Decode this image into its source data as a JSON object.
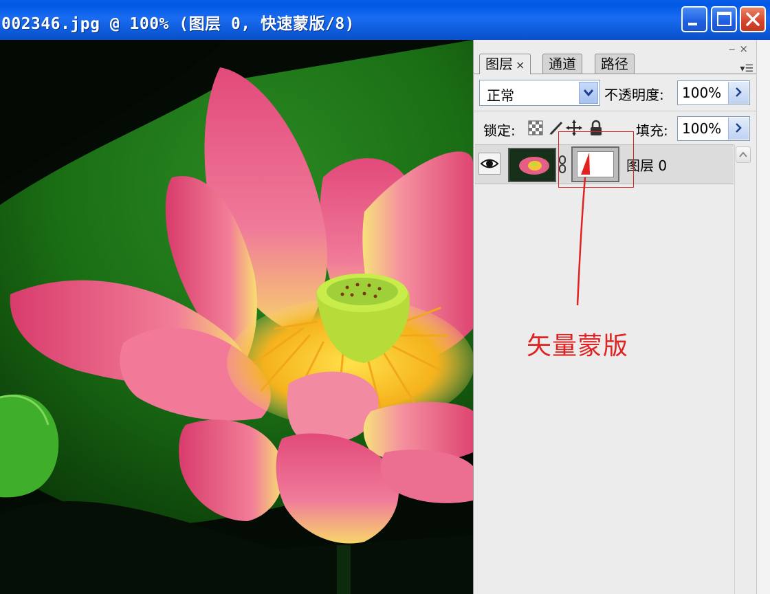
{
  "window": {
    "title": "002346.jpg @ 100% (图层 0, 快速蒙版/8)",
    "buttons": [
      "minimize",
      "maximize",
      "close"
    ]
  },
  "panel": {
    "tabs": [
      {
        "label": "图层",
        "close": "×",
        "active": true
      },
      {
        "label": "通道",
        "active": false
      },
      {
        "label": "路径",
        "active": false
      }
    ],
    "blend_mode": "正常",
    "opacity_label": "不透明度:",
    "opacity_value": "100%",
    "lock_label": "锁定:",
    "fill_label": "填充:",
    "fill_value": "100%",
    "layers": [
      {
        "name": "图层 0",
        "visible": true,
        "has_vector_mask": true
      }
    ],
    "icons": [
      "panel-collapse-icon",
      "panel-close-icon",
      "panel-menu-icon",
      "eye-icon",
      "chain-icon",
      "lock-transparent-icon",
      "lock-brush-icon",
      "lock-move-icon",
      "lock-all-icon"
    ]
  },
  "annotation": {
    "text": "矢量蒙版",
    "color": "#e02222"
  },
  "colors": {
    "titlebar": "#0058e6",
    "panel_bg": "#ececec"
  }
}
